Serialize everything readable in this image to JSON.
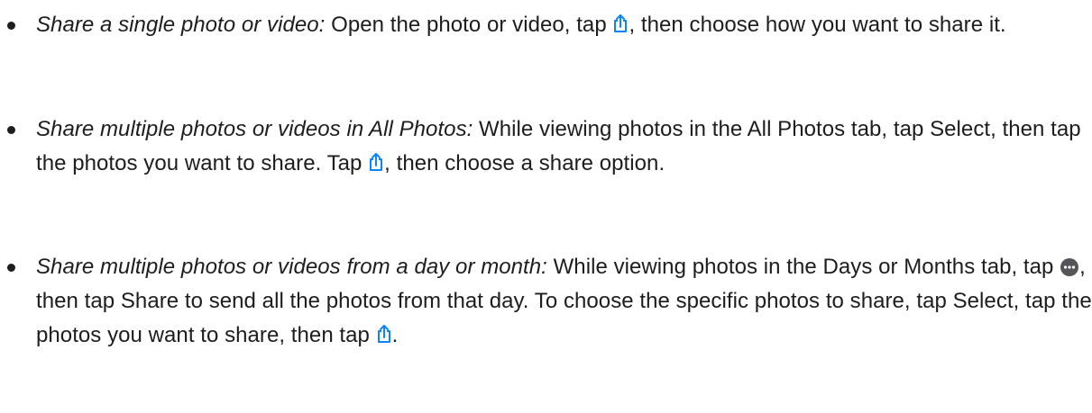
{
  "items": [
    {
      "term": "Share a single photo or video:",
      "text_a": " Open the photo or video, tap ",
      "icon_a": "share-icon",
      "text_b": ", then choose how you want to share it."
    },
    {
      "term": "Share multiple photos or videos in All Photos:",
      "text_a": " While viewing photos in the All Photos tab, tap Select, then tap the photos you want to share. Tap ",
      "icon_a": "share-icon",
      "text_b": ", then choose a share option."
    },
    {
      "term": "Share multiple photos or videos from a day or month:",
      "text_a": " While viewing photos in the Days or Months tab, tap ",
      "icon_a": "more-icon",
      "text_b": ", then tap Share to send all the photos from that day. To choose the specific photos to share, tap Select, tap the photos you want to share, then tap ",
      "icon_b": "share-icon",
      "text_c": "."
    }
  ],
  "colors": {
    "text": "#1d1d1f",
    "share_icon": "#0a84ff",
    "more_icon": "#555559"
  }
}
